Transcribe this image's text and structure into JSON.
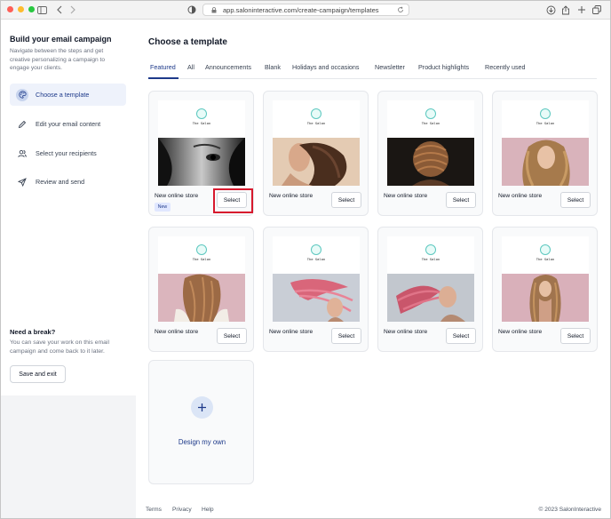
{
  "browser": {
    "url": "app.saloninteractive.com/create-campaign/templates"
  },
  "sidebar": {
    "title": "Build your email campaign",
    "description": "Navigate between the steps and get creative personalizing a campaign to engage your clients.",
    "steps": [
      {
        "label": "Choose a template",
        "icon": "palette-icon",
        "active": true
      },
      {
        "label": "Edit your email content",
        "icon": "pencil-icon",
        "active": false
      },
      {
        "label": "Select your recipients",
        "icon": "users-icon",
        "active": false
      },
      {
        "label": "Review and send",
        "icon": "send-icon",
        "active": false
      }
    ],
    "break_title": "Need a break?",
    "break_desc": "You can save your work on this email campaign and come back to it later.",
    "save_exit_label": "Save and exit"
  },
  "main": {
    "title": "Choose a template",
    "tabs": [
      "Featured",
      "All",
      "Announcements",
      "Blank",
      "Holidays and occasions",
      "Newsletter",
      "Product highlights",
      "Recently used"
    ],
    "active_tab": "Featured",
    "brand_text": "The Salon",
    "templates": [
      {
        "name": "New online store",
        "badge": "New",
        "select": "Select"
      },
      {
        "name": "New online store",
        "select": "Select"
      },
      {
        "name": "New online store",
        "select": "Select"
      },
      {
        "name": "New online store",
        "select": "Select"
      },
      {
        "name": "New online store",
        "select": "Select"
      },
      {
        "name": "New online store",
        "select": "Select"
      },
      {
        "name": "New online store",
        "select": "Select"
      },
      {
        "name": "New online store",
        "select": "Select"
      }
    ],
    "design_label": "Design my own"
  },
  "footer": {
    "links": [
      "Terms",
      "Privacy",
      "Help"
    ],
    "copyright": "© 2023 SalonInteractive"
  },
  "colors": {
    "accent": "#1e3a8a",
    "highlight": "#d7192d",
    "logo": "#5cc8bf"
  }
}
